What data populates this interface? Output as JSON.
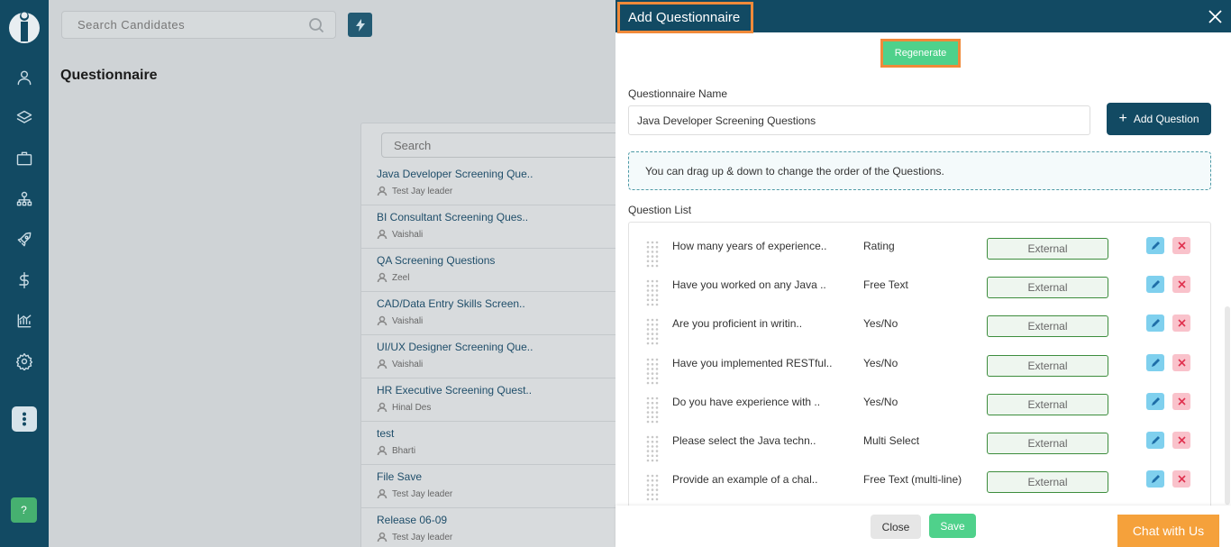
{
  "sidebar": {
    "nav": [
      "user-icon",
      "layers-icon",
      "briefcase-icon",
      "org-chart-icon",
      "rocket-icon",
      "dollar-icon",
      "analytics-icon",
      "gear-icon"
    ],
    "help_label": "?"
  },
  "background": {
    "search_placeholder": "Search Candidates",
    "page_title": "Questionnaire",
    "list_search_placeholder": "Search",
    "items": [
      {
        "title": "Java Developer Screening Que..",
        "owner": "Test Jay leader"
      },
      {
        "title": "BI Consultant Screening Ques..",
        "owner": "Vaishali"
      },
      {
        "title": "QA Screening Questions",
        "owner": "Zeel"
      },
      {
        "title": "CAD/Data Entry Skills Screen..",
        "owner": "Vaishali"
      },
      {
        "title": "UI/UX Designer Screening Que..",
        "owner": "Vaishali"
      },
      {
        "title": "HR Executive Screening Quest..",
        "owner": "Hinal Des"
      },
      {
        "title": "test",
        "owner": "Bharti"
      },
      {
        "title": "File Save",
        "owner": "Test Jay leader"
      },
      {
        "title": "Release 06-09",
        "owner": "Test Jay leader"
      }
    ]
  },
  "modal": {
    "title": "Add Questionnaire",
    "regenerate_label": "Regenerate",
    "name_label": "Questionnaire Name",
    "name_value": "Java Developer Screening Questions",
    "add_question_label": "Add Question",
    "info_text": "You can drag up & down to change the order of the Questions.",
    "list_label": "Question List",
    "questions": [
      {
        "text": "How many years of experience..",
        "type": "Rating",
        "source": "External"
      },
      {
        "text": "Have you worked on any Java ..",
        "type": "Free Text",
        "source": "External"
      },
      {
        "text": "Are you proficient in writin..",
        "type": "Yes/No",
        "source": "External"
      },
      {
        "text": "Have you implemented RESTful..",
        "type": "Yes/No",
        "source": "External"
      },
      {
        "text": "Do you have experience with ..",
        "type": "Yes/No",
        "source": "External"
      },
      {
        "text": "Please select the Java techn..",
        "type": "Multi Select",
        "source": "External"
      },
      {
        "text": "Provide an example of a chal..",
        "type": "Free Text (multi-line)",
        "source": "External"
      }
    ],
    "close_label": "Close",
    "save_label": "Save"
  },
  "chat_label": "Chat with Us",
  "colors": {
    "primary": "#124a63",
    "accent_green": "#4fd18b",
    "highlight_orange": "#f08a3a",
    "chat_orange": "#f5a13b"
  }
}
